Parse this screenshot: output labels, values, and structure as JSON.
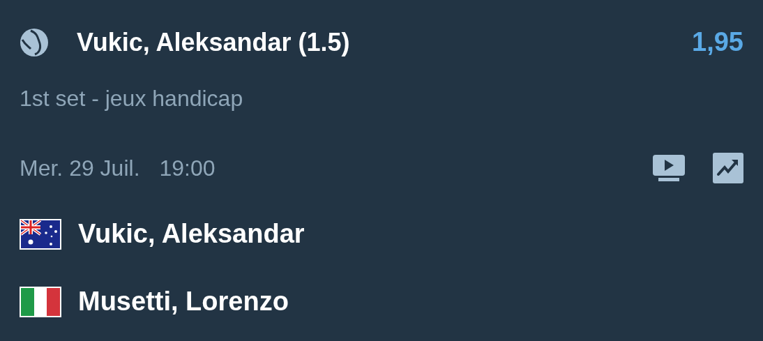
{
  "selection": {
    "label": "Vukic, Aleksandar (1.5)",
    "odds": "1,95",
    "market": "1st set - jeux handicap"
  },
  "event": {
    "date": "Mer. 29 Juil.",
    "time": "19:00",
    "live_stream": true,
    "stats": true
  },
  "players": [
    {
      "name": "Vukic, Aleksandar",
      "kind": "au"
    },
    {
      "name": "Musetti, Lorenzo",
      "kind": "it"
    }
  ]
}
